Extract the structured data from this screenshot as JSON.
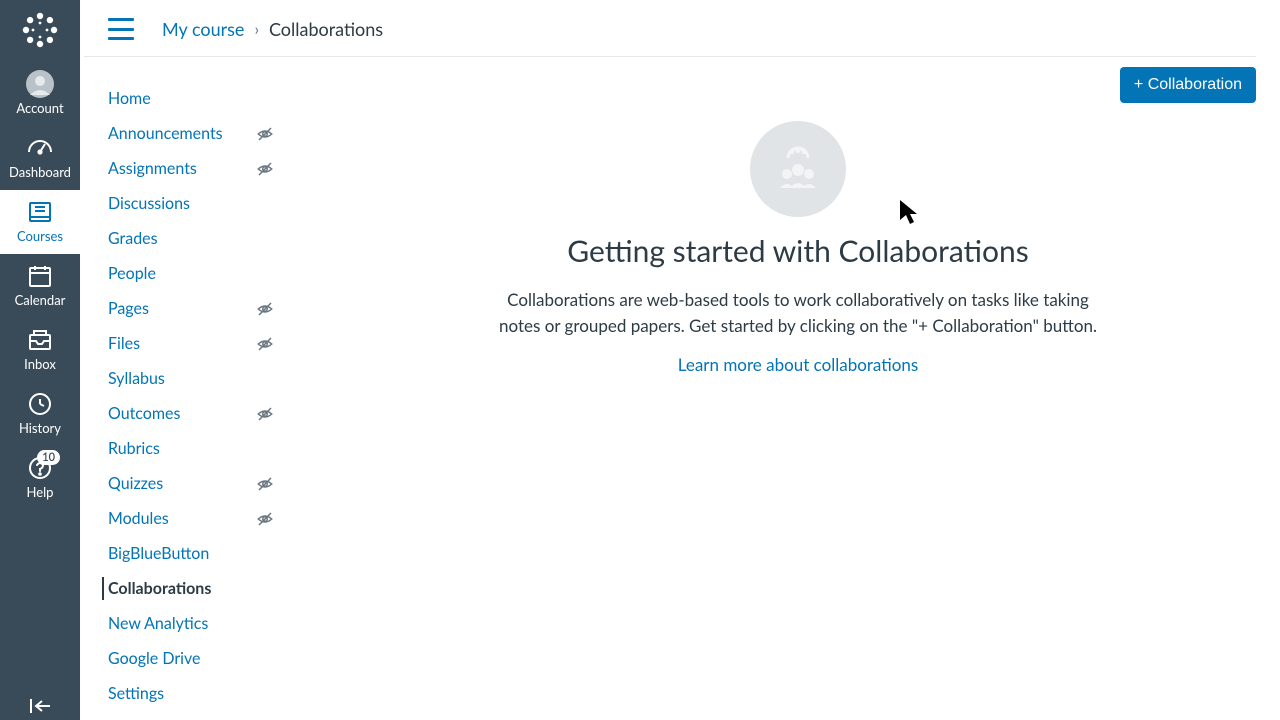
{
  "global_nav": {
    "items": [
      {
        "label": "Account"
      },
      {
        "label": "Dashboard"
      },
      {
        "label": "Courses"
      },
      {
        "label": "Calendar"
      },
      {
        "label": "Inbox"
      },
      {
        "label": "History"
      },
      {
        "label": "Help"
      }
    ],
    "help_badge": "10"
  },
  "breadcrumb": {
    "course": "My course",
    "current": "Collaborations"
  },
  "course_nav": [
    {
      "label": "Home",
      "hidden": false,
      "active": false
    },
    {
      "label": "Announcements",
      "hidden": true,
      "active": false
    },
    {
      "label": "Assignments",
      "hidden": true,
      "active": false
    },
    {
      "label": "Discussions",
      "hidden": false,
      "active": false
    },
    {
      "label": "Grades",
      "hidden": false,
      "active": false
    },
    {
      "label": "People",
      "hidden": false,
      "active": false
    },
    {
      "label": "Pages",
      "hidden": true,
      "active": false
    },
    {
      "label": "Files",
      "hidden": true,
      "active": false
    },
    {
      "label": "Syllabus",
      "hidden": false,
      "active": false
    },
    {
      "label": "Outcomes",
      "hidden": true,
      "active": false
    },
    {
      "label": "Rubrics",
      "hidden": false,
      "active": false
    },
    {
      "label": "Quizzes",
      "hidden": true,
      "active": false
    },
    {
      "label": "Modules",
      "hidden": true,
      "active": false
    },
    {
      "label": "BigBlueButton",
      "hidden": false,
      "active": false
    },
    {
      "label": "Collaborations",
      "hidden": false,
      "active": true
    },
    {
      "label": "New Analytics",
      "hidden": false,
      "active": false
    },
    {
      "label": "Google Drive",
      "hidden": false,
      "active": false
    },
    {
      "label": "Settings",
      "hidden": false,
      "active": false
    }
  ],
  "main": {
    "add_button": "+ Collaboration",
    "title": "Getting started with Collaborations",
    "description": "Collaborations are web-based tools to work collaboratively on tasks like taking notes or grouped papers. Get started by clicking on the \"+ Collaboration\" button.",
    "learn_link": "Learn more about collaborations"
  }
}
